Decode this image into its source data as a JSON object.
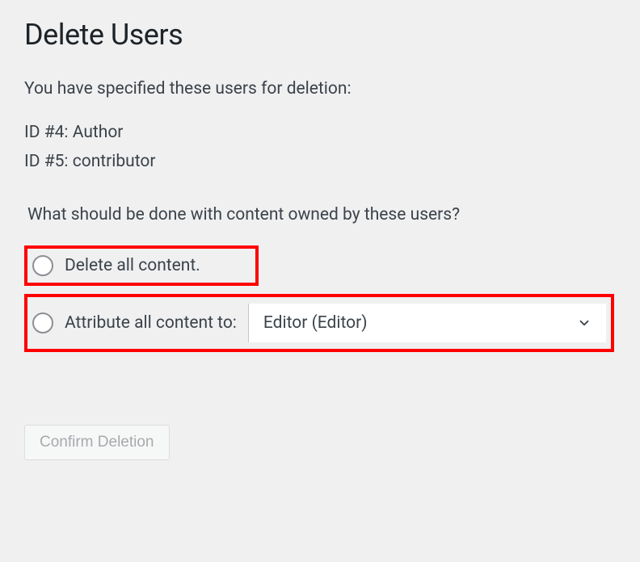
{
  "title": "Delete Users",
  "subtitle": "You have specified these users for deletion:",
  "users": [
    "ID #4: Author",
    "ID #5: contributor"
  ],
  "question": "What should be done with content owned by these users?",
  "options": {
    "delete_label": "Delete all content.",
    "attribute_label": "Attribute all content to:",
    "attribute_select_value": "Editor (Editor)"
  },
  "confirm_button": "Confirm Deletion"
}
